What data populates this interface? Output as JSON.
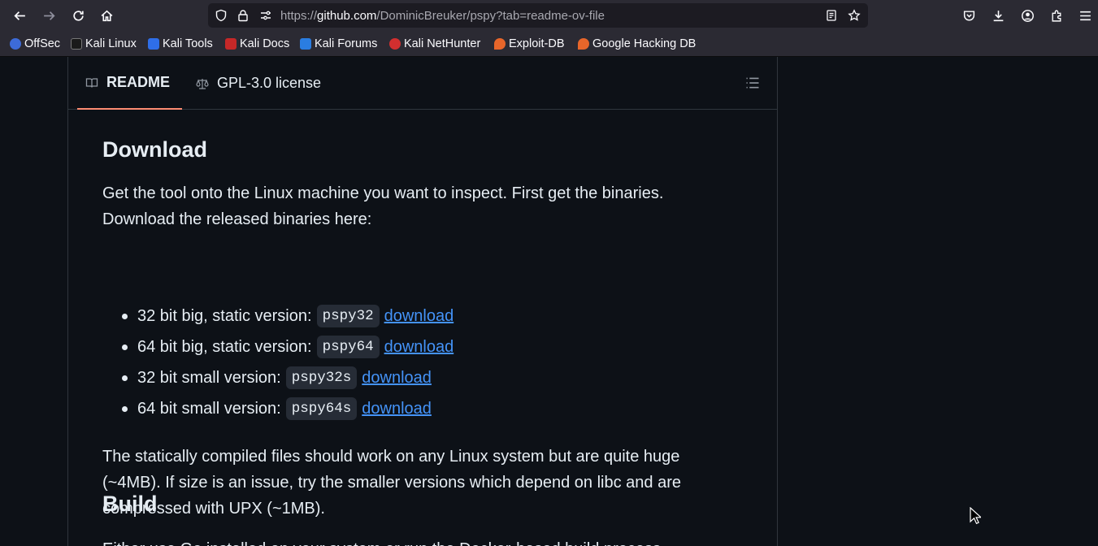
{
  "browser": {
    "url_prefix": "https://",
    "url_host": "github.com",
    "url_path": "/DominicBreuker/pspy?tab=readme-ov-file",
    "bookmarks": [
      {
        "label": "OffSec",
        "color": "#3d6bd8"
      },
      {
        "label": "Kali Linux",
        "color": "#222222"
      },
      {
        "label": "Kali Tools",
        "color": "#2f6ee8"
      },
      {
        "label": "Kali Docs",
        "color": "#c62828"
      },
      {
        "label": "Kali Forums",
        "color": "#2a7de1"
      },
      {
        "label": "Kali NetHunter",
        "color": "#d32f2f"
      },
      {
        "label": "Exploit-DB",
        "color": "#e8662a"
      },
      {
        "label": "Google Hacking DB",
        "color": "#e8662a"
      }
    ]
  },
  "readme": {
    "tabs": [
      {
        "label": "README",
        "icon": "book-icon",
        "active": true
      },
      {
        "label": "GPL-3.0 license",
        "icon": "law-icon",
        "active": false
      }
    ],
    "download_heading": "Download",
    "intro": "Get the tool onto the Linux machine you want to inspect. First get the binaries. Download the released binaries here:",
    "items": [
      {
        "text": "32 bit big, static version:",
        "code": "pspy32",
        "link": "download"
      },
      {
        "text": "64 bit big, static version:",
        "code": "pspy64",
        "link": "download"
      },
      {
        "text": "32 bit small version:",
        "code": "pspy32s",
        "link": "download"
      },
      {
        "text": "64 bit small version:",
        "code": "pspy64s",
        "link": "download"
      }
    ],
    "size_note": "The statically compiled files should work on any Linux system but are quite huge (~4MB). If size is an issue, try the smaller versions which depend on libc and are compressed with UPX (~1MB).",
    "build_heading": "Build",
    "build_text": "Either use Go installed on your system or run the Docker-based build process."
  }
}
